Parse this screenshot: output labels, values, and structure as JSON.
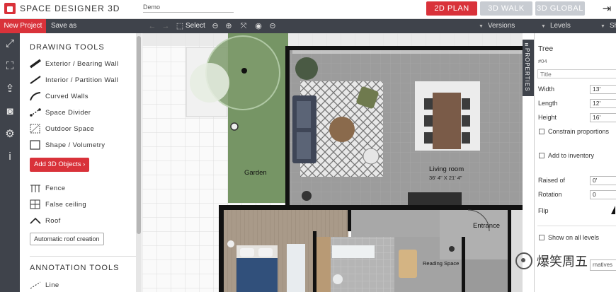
{
  "app": {
    "title": "SPACE DESIGNER 3D",
    "project_name": "Demo",
    "view_tabs": [
      {
        "label": "2D PLAN",
        "active": true
      },
      {
        "label": "3D WALK",
        "active": false
      },
      {
        "label": "3D GLOBAL",
        "active": false
      }
    ],
    "accent_color": "#d9323a"
  },
  "toolbar": {
    "new_project": "New Project",
    "save_as": "Save as",
    "select": "Select",
    "versions": "Versions",
    "levels": "Levels",
    "share_partial": "Sh"
  },
  "left_panel": {
    "drawing_tools_title": "DRAWING TOOLS",
    "drawing_tools": [
      "Exterior / Bearing Wall",
      "Interior / Partition Wall",
      "Curved Walls",
      "Space Divider",
      "Outdoor Space",
      "Shape / Volumetry"
    ],
    "add_3d_objects": "Add 3D Objects ›",
    "extra_tools": [
      "Fence",
      "False ceiling",
      "Roof"
    ],
    "auto_roof": "Automatic roof creation",
    "annotation_tools_title": "ANNOTATION TOOLS",
    "annotation_tools": [
      "Line"
    ]
  },
  "plan": {
    "garden": "Garden",
    "living_room": "Living room",
    "living_room_dims": "36' 4\" X 21' 4\"",
    "entrance": "Entrance",
    "reading_space": "Reading Space"
  },
  "properties": {
    "tab_label": "PROPERTIES",
    "object_name": "Tree",
    "object_id": "#04",
    "title_placeholder": "Title",
    "width_label": "Width",
    "width_value": "13'",
    "length_label": "Length",
    "length_value": "12'",
    "height_label": "Height",
    "height_value": "16'",
    "constrain_label": "Constrain proportions",
    "add_inventory_label": "Add to inventory",
    "raised_label": "Raised of",
    "raised_value": "0'",
    "rotation_label": "Rotation",
    "rotation_value": "0",
    "flip_label": "Flip",
    "show_all_levels_label": "Show on all levels",
    "alternatives_partial": "rnatives"
  },
  "watermark": {
    "text": "爆笑周五"
  }
}
